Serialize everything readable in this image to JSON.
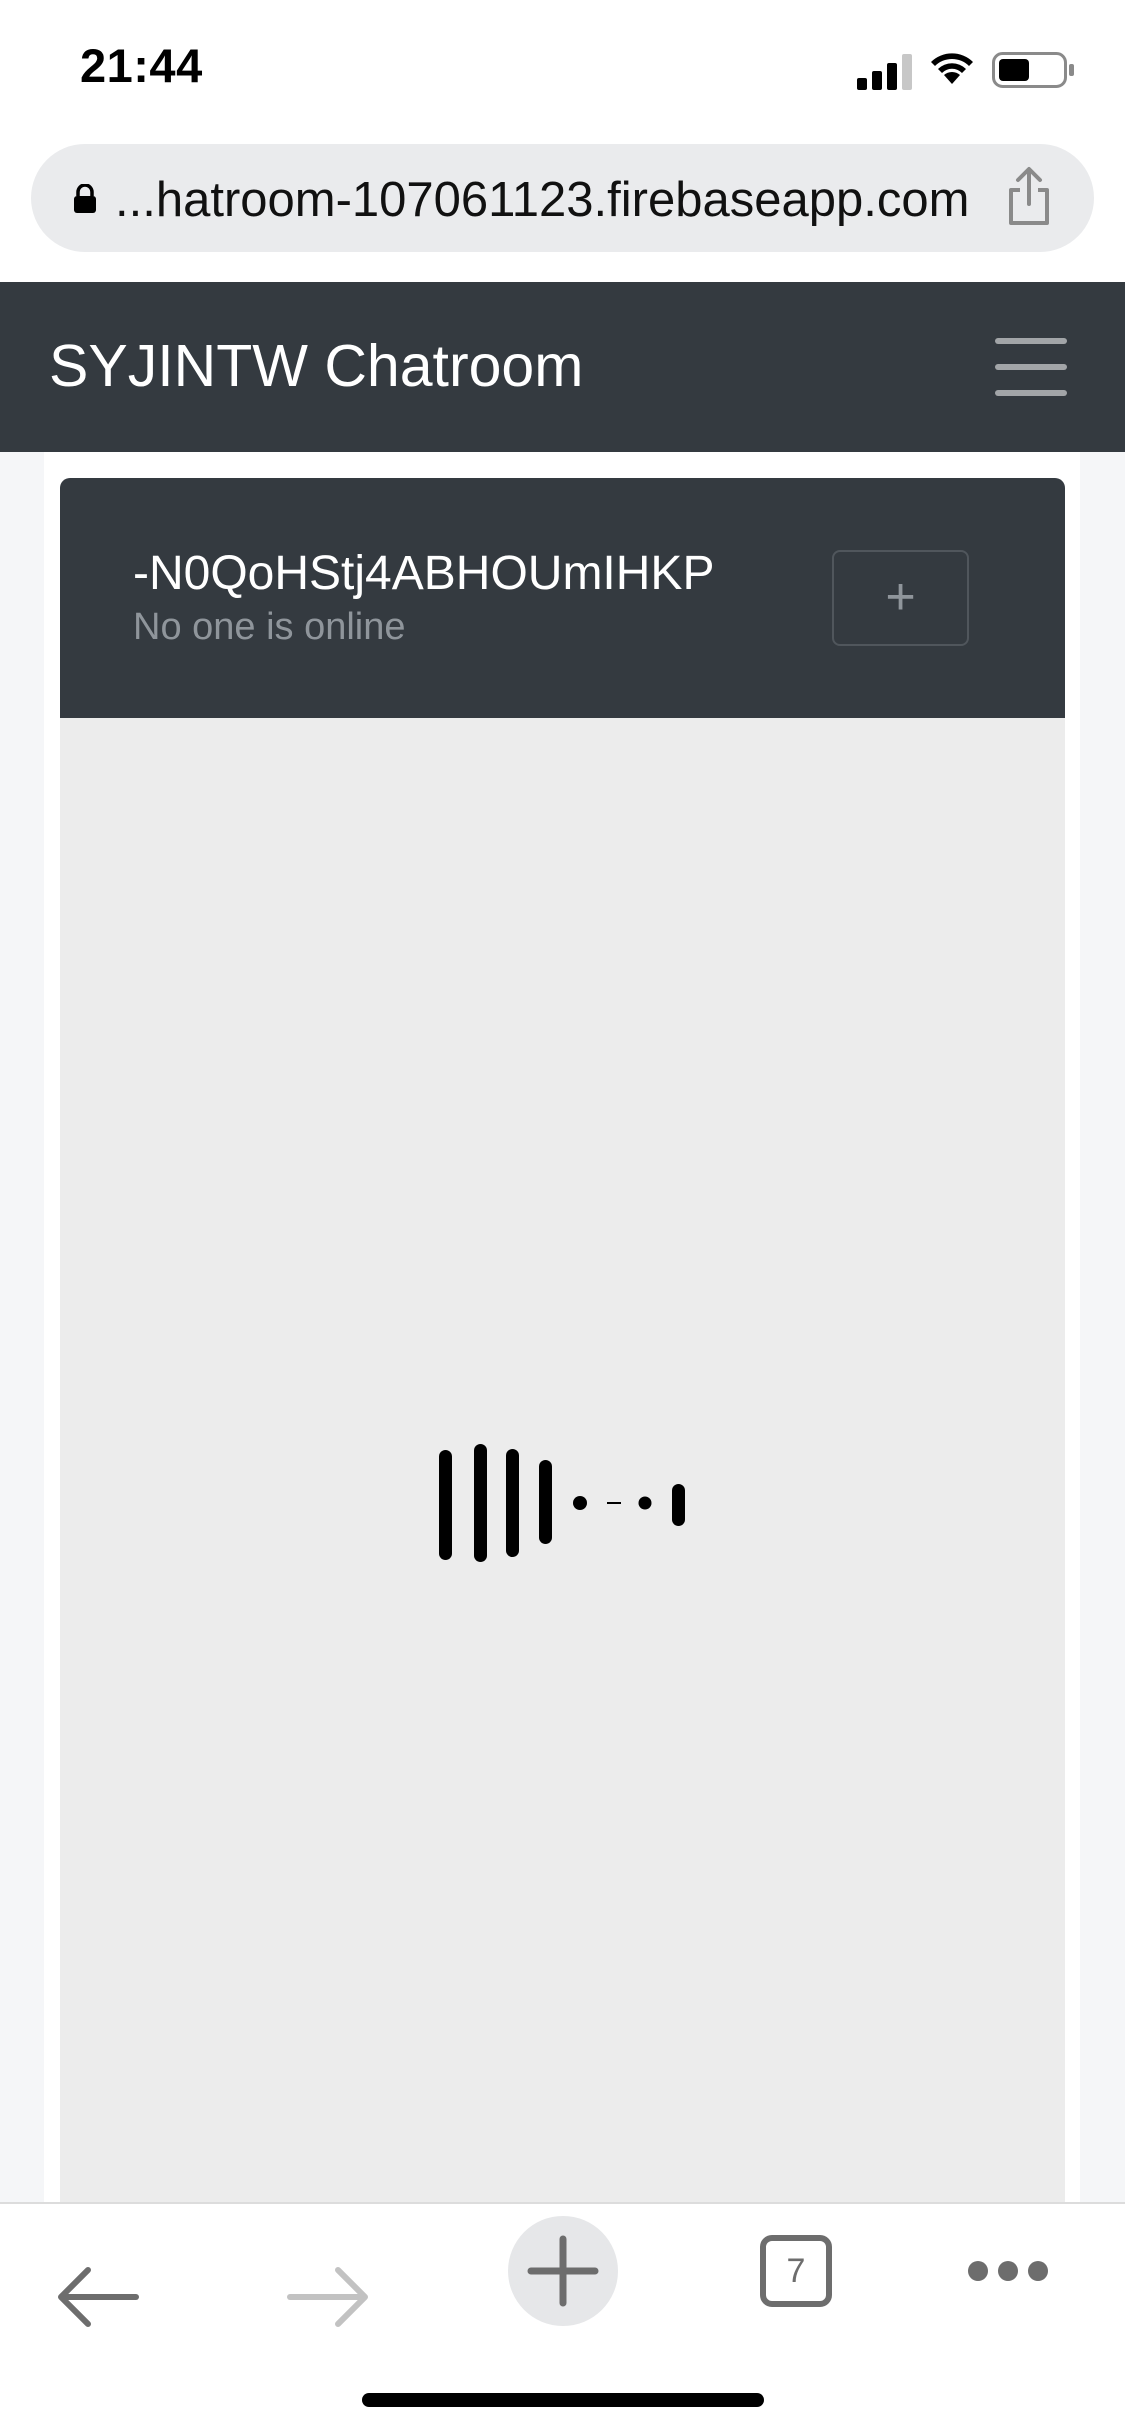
{
  "status_bar": {
    "time": "21:44",
    "icons": [
      "cellular-signal-icon",
      "wifi-icon",
      "battery-icon"
    ]
  },
  "browser": {
    "url": "...hatroom-107061123.firebaseapp.com",
    "tab_count": "7"
  },
  "navbar": {
    "brand": "SYJINTW Chatroom"
  },
  "chat": {
    "room_id": "-N0QoHStj4ABHOUmIHKP",
    "online_status": "No one is online",
    "add_label": "+"
  },
  "colors": {
    "navbar_bg": "#343a40",
    "chat_bg": "#ececec",
    "url_bar_bg": "#eaebed",
    "muted_text": "#8f959b"
  }
}
